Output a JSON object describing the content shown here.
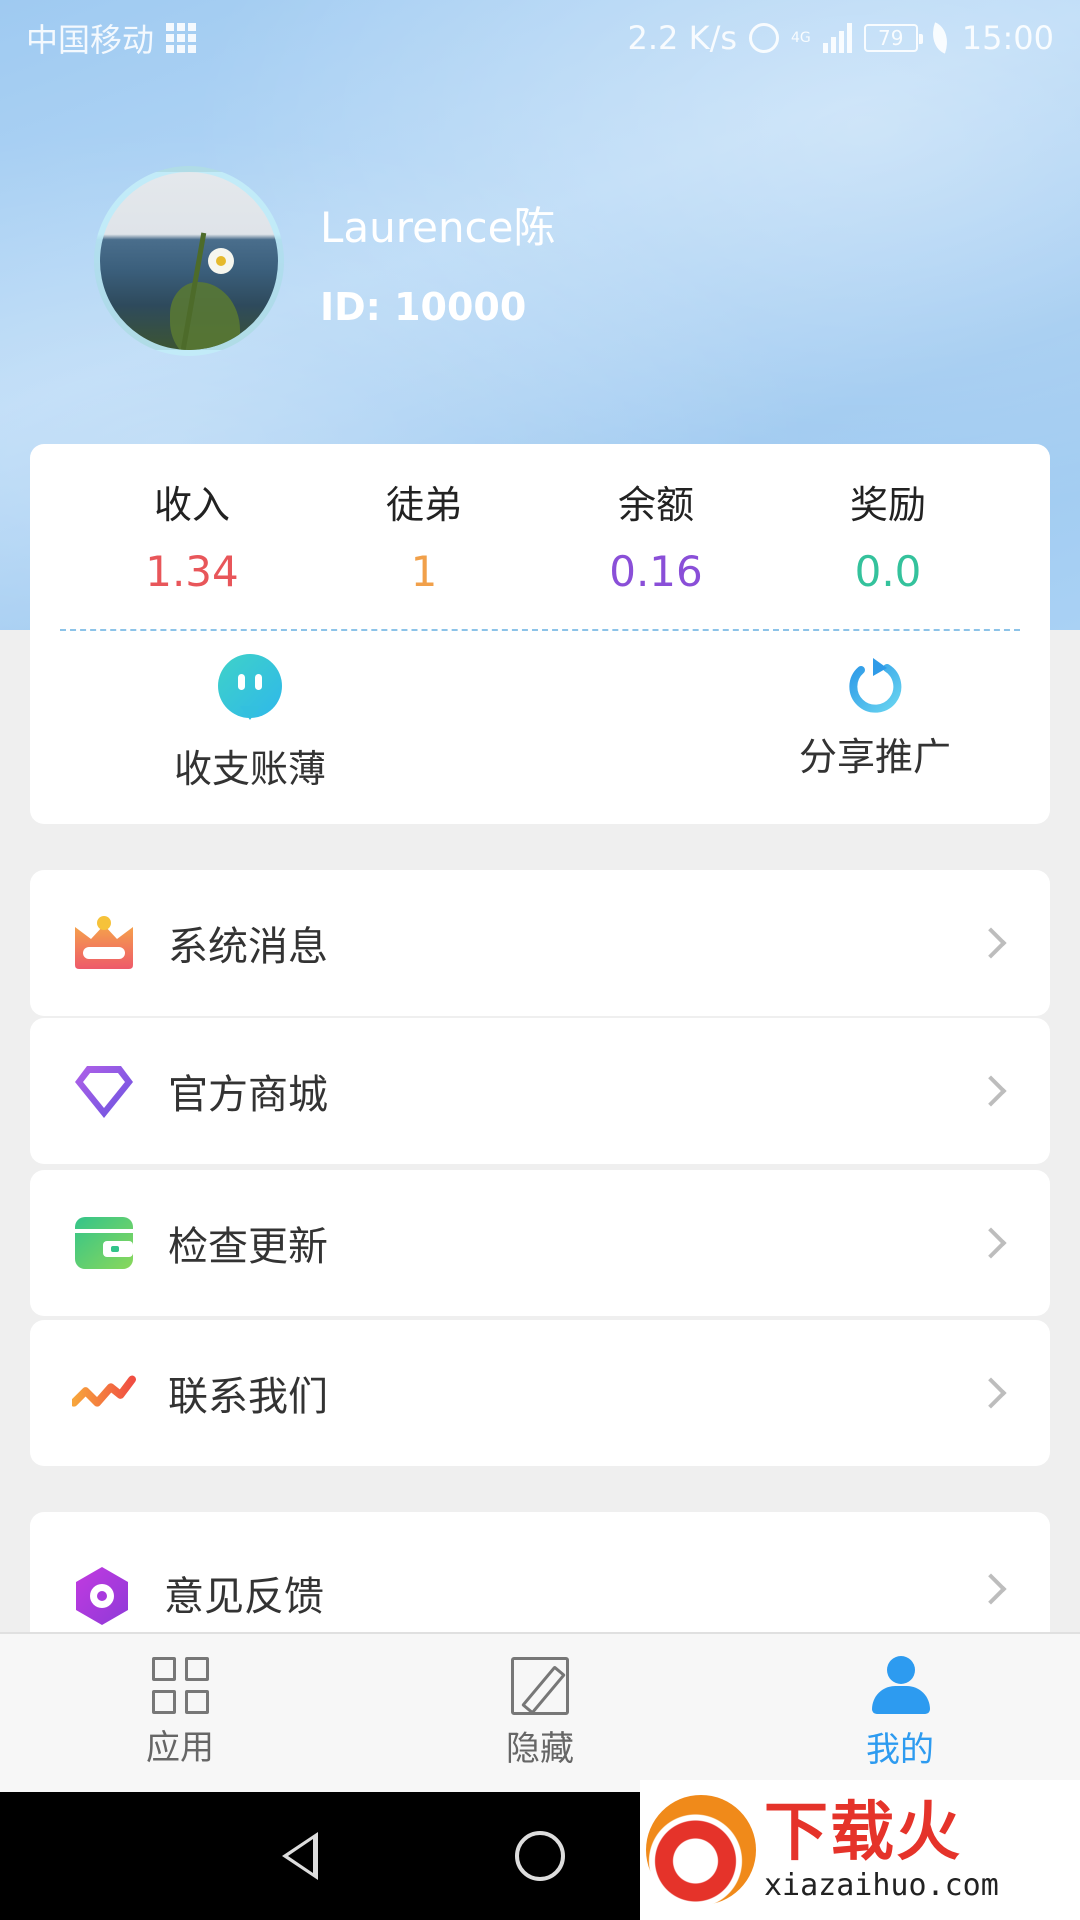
{
  "status_bar": {
    "carrier": "中国移动",
    "speed": "2.2 K/s",
    "network": "4G",
    "battery": "79",
    "time": "15:00"
  },
  "profile": {
    "name": "Laurence陈",
    "id": "ID: 10000"
  },
  "stats": [
    {
      "label": "收入",
      "value": "1.34",
      "color": "#e8565a"
    },
    {
      "label": "徒弟",
      "value": "1",
      "color": "#f1a04a"
    },
    {
      "label": "余额",
      "value": "0.16",
      "color": "#8a4fd8"
    },
    {
      "label": "奖励",
      "value": "0.0",
      "color": "#34c29c"
    }
  ],
  "quick_actions": {
    "ledger": "收支账薄",
    "share": "分享推广"
  },
  "menu": [
    {
      "label": "系统消息",
      "icon": "crown-icon"
    },
    {
      "label": "官方商城",
      "icon": "diamond-icon"
    },
    {
      "label": "检查更新",
      "icon": "wallet-icon"
    },
    {
      "label": "联系我们",
      "icon": "trend-icon"
    },
    {
      "label": "意见反馈",
      "icon": "hexagon-icon"
    }
  ],
  "tabs": [
    {
      "label": "应用",
      "icon": "grid-icon",
      "active": false
    },
    {
      "label": "隐藏",
      "icon": "edit-icon",
      "active": false
    },
    {
      "label": "我的",
      "icon": "person-icon",
      "active": true
    }
  ],
  "colors": {
    "tab_active": "#2d9bf0",
    "tab_inactive": "#666666"
  },
  "watermark": {
    "brand": "下载火",
    "url": "xiazaihuo.com"
  }
}
